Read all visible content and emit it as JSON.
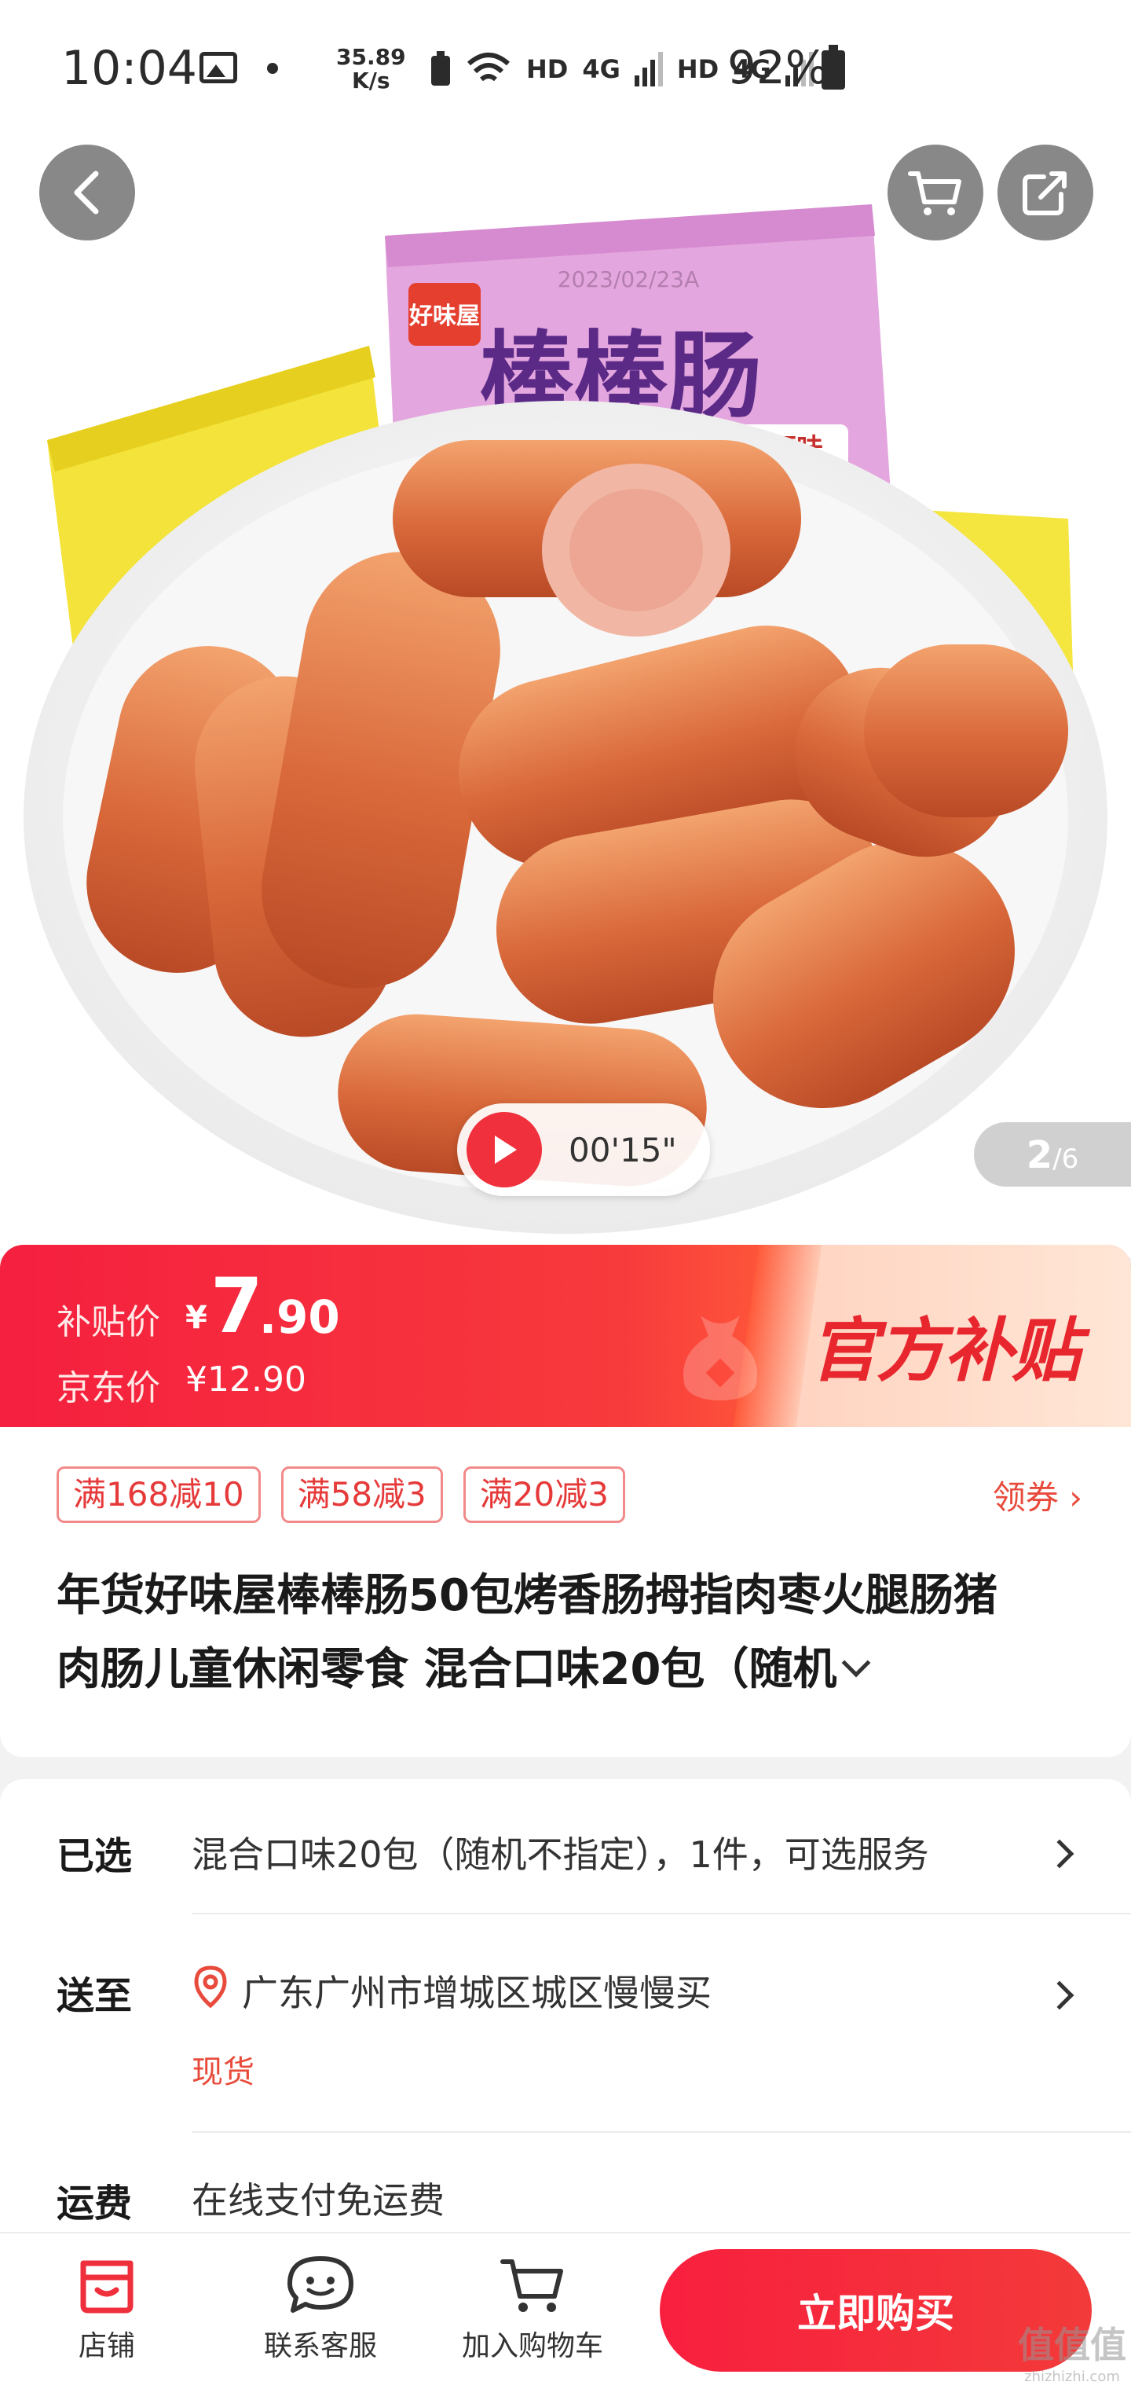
{
  "status_bar": {
    "time": "10:04",
    "net_speed_value": "35.89",
    "net_speed_unit": "K/s",
    "hd1": "HD",
    "net1": "4G",
    "hd2": "HD",
    "net2": "4G",
    "battery": "92%"
  },
  "product_image": {
    "brand": "好味屋",
    "package_name": "棒棒肠",
    "flavor": "火鸡面味",
    "print_date": "2023/02/23A",
    "video_duration": "00'15\"",
    "image_index": "2",
    "image_total": "/6"
  },
  "price": {
    "subsidy_label": "补贴价",
    "currency": "¥",
    "subsidy_integer": "7",
    "subsidy_decimal": ".90",
    "jd_label": "京东价",
    "jd_price": "¥12.90",
    "badge_text": "官方补贴"
  },
  "coupons": {
    "items": [
      "满168减10",
      "满58减3",
      "满20减3"
    ],
    "link_label": "领券 ›"
  },
  "title": {
    "line1": "年货好味屋棒棒肠50包烤香肠拇指肉枣火腿肠猪",
    "line2": "肉肠儿童休闲零食 混合口味20包（随机"
  },
  "info": {
    "selected_label": "已选",
    "selected_value": "混合口味20包（随机不指定），1件，可选服务",
    "ship_label": "送至",
    "ship_value": "广东广州市增城区城区慢慢买",
    "stock_status": "现货",
    "freight_label": "运费",
    "freight_value": "在线支付免运费"
  },
  "bottom_bar": {
    "shop_label": "店铺",
    "service_label": "联系客服",
    "cart_label": "加入购物车",
    "buy_label": "立即购买"
  },
  "watermark": {
    "main": "值值值",
    "sub": "zhizhizhi.com"
  },
  "colors": {
    "primary_red": "#f51f3f",
    "accent_text_red": "#e84b3c",
    "coupon_border": "#f28a8a"
  },
  "icons": [
    "back-arrow-icon",
    "cart-icon",
    "share-icon",
    "play-icon",
    "location-pin-icon",
    "shop-icon",
    "customer-service-icon",
    "add-cart-icon"
  ]
}
